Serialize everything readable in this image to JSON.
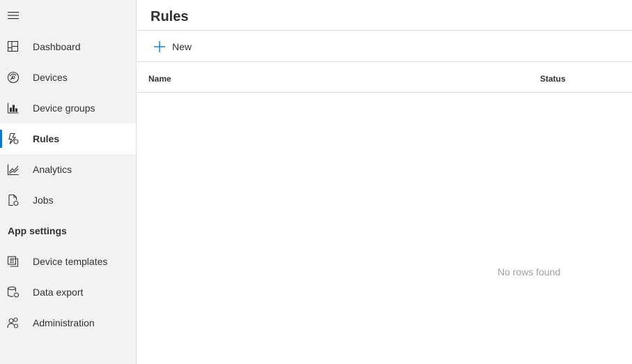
{
  "sidebar": {
    "menu_icon": "hamburger-icon",
    "items": [
      {
        "label": "Dashboard",
        "icon": "dashboard-icon"
      },
      {
        "label": "Devices",
        "icon": "devices-icon"
      },
      {
        "label": "Device groups",
        "icon": "device-groups-icon"
      },
      {
        "label": "Rules",
        "icon": "rules-icon",
        "active": true
      },
      {
        "label": "Analytics",
        "icon": "analytics-icon"
      },
      {
        "label": "Jobs",
        "icon": "jobs-icon"
      }
    ],
    "section_title": "App settings",
    "settings_items": [
      {
        "label": "Device templates",
        "icon": "device-templates-icon"
      },
      {
        "label": "Data export",
        "icon": "data-export-icon"
      },
      {
        "label": "Administration",
        "icon": "administration-icon"
      }
    ]
  },
  "main": {
    "title": "Rules",
    "toolbar": {
      "new_label": "New",
      "new_icon": "plus-icon"
    },
    "table": {
      "columns": [
        "Name",
        "Status"
      ],
      "empty_message": "No rows found"
    }
  },
  "colors": {
    "accent": "#0078d4",
    "sidebar_bg": "#f3f2f1",
    "muted_text": "#a19f9d"
  }
}
